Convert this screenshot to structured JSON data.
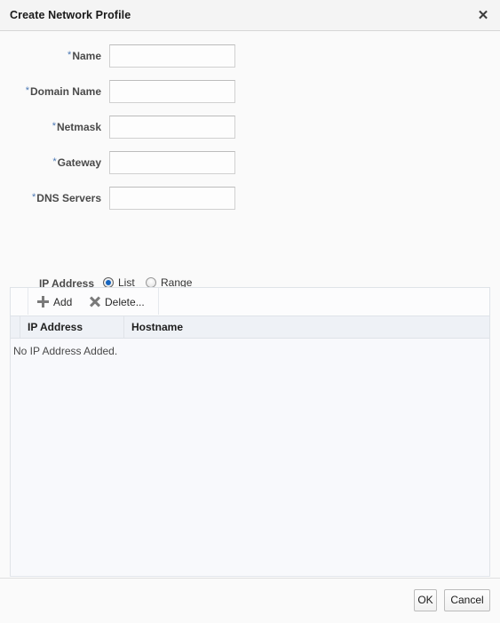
{
  "dialog": {
    "title": "Create Network Profile",
    "close_icon": "close-icon",
    "close_glyph": "✕"
  },
  "form": {
    "fields": [
      {
        "label": "Name",
        "required": true,
        "value": "",
        "placeholder": ""
      },
      {
        "label": "Domain Name",
        "required": true,
        "value": "",
        "placeholder": ""
      },
      {
        "label": "Netmask",
        "required": true,
        "value": "",
        "placeholder": ""
      },
      {
        "label": "Gateway",
        "required": true,
        "value": "",
        "placeholder": ""
      },
      {
        "label": "DNS Servers",
        "required": true,
        "value": "",
        "placeholder": ""
      }
    ],
    "required_marker": "*"
  },
  "ip_address": {
    "label": "IP Address",
    "options": [
      {
        "label": "List",
        "selected": true
      },
      {
        "label": "Range",
        "selected": false
      }
    ]
  },
  "toolbar": {
    "add_label": "Add",
    "add_icon": "plus-icon",
    "delete_label": "Delete...",
    "delete_icon": "x-icon"
  },
  "table": {
    "columns": [
      "IP Address",
      "Hostname"
    ],
    "rows": [],
    "empty_message": "No IP Address Added."
  },
  "footer": {
    "ok_label": "OK",
    "cancel_label": "Cancel"
  },
  "colors": {
    "accent": "#1565c0",
    "required_star": "#4a77b4",
    "header_band": "#eef1f6",
    "table_body": "#f8f9fc",
    "dialog_bg": "#fafafa",
    "titlebar_bg": "#f4f4f4",
    "border": "#dfe3e8"
  }
}
